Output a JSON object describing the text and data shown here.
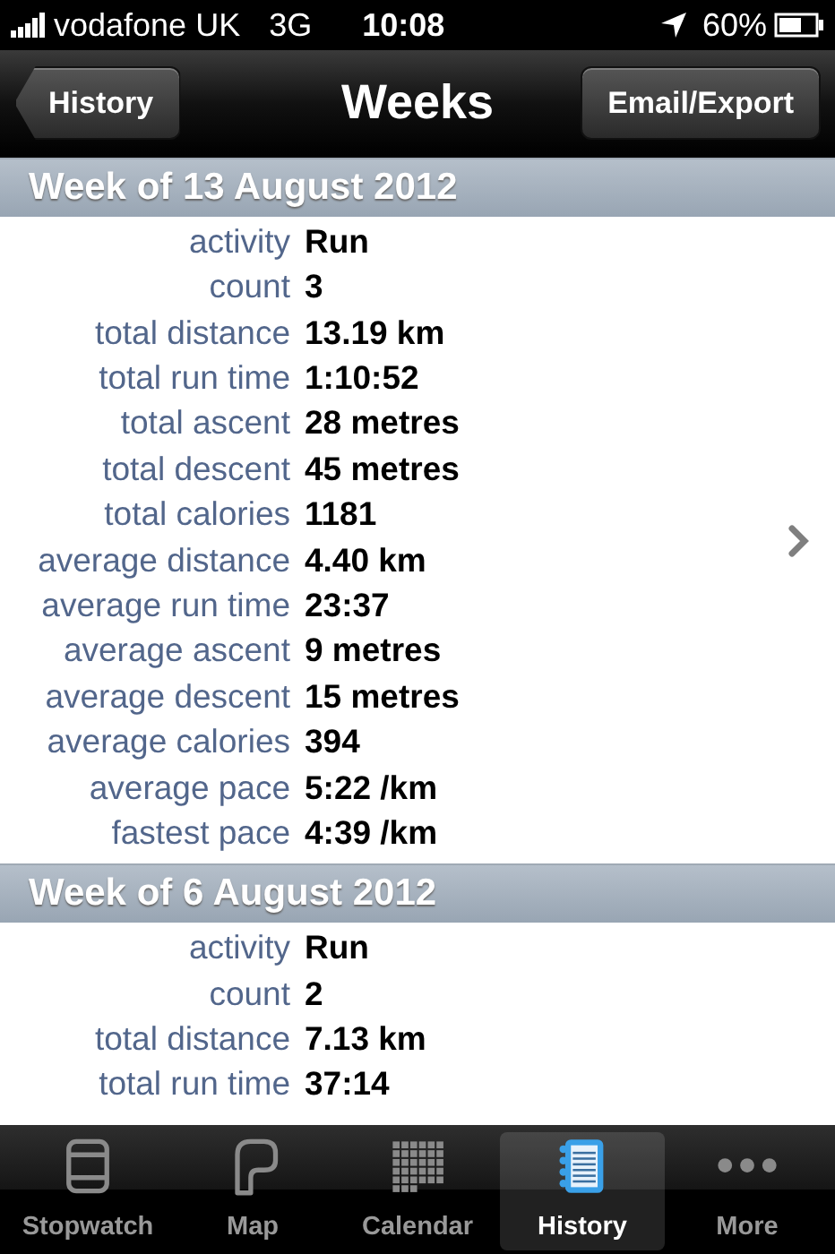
{
  "status_bar": {
    "carrier": "vodafone UK",
    "network": "3G",
    "time": "10:08",
    "battery": "60%"
  },
  "nav_bar": {
    "back": "History",
    "title": "Weeks",
    "action": "Email/Export"
  },
  "sections": [
    {
      "title": "Week of 13 August 2012",
      "disclosure": true,
      "rows": [
        {
          "label": "activity",
          "value": "Run"
        },
        {
          "label": "count",
          "value": "3"
        },
        {
          "label": "total distance",
          "value": "13.19 km"
        },
        {
          "label": "total run time",
          "value": "1:10:52"
        },
        {
          "label": "total ascent",
          "value": "28 metres"
        },
        {
          "label": "total descent",
          "value": "45 metres"
        },
        {
          "label": "total calories",
          "value": "1181"
        },
        {
          "label": "average distance",
          "value": "4.40 km"
        },
        {
          "label": "average run time",
          "value": "23:37"
        },
        {
          "label": "average ascent",
          "value": "9 metres"
        },
        {
          "label": "average descent",
          "value": "15 metres"
        },
        {
          "label": "average calories",
          "value": "394"
        },
        {
          "label": "average pace",
          "value": "5:22 /km"
        },
        {
          "label": "fastest pace",
          "value": "4:39 /km"
        }
      ]
    },
    {
      "title": "Week of 6 August 2012",
      "disclosure": false,
      "rows": [
        {
          "label": "activity",
          "value": "Run"
        },
        {
          "label": "count",
          "value": "2"
        },
        {
          "label": "total distance",
          "value": "7.13 km"
        },
        {
          "label": "total run time",
          "value": "37:14"
        }
      ]
    }
  ],
  "tab_bar": [
    {
      "kind": "stopwatch",
      "label": "Stopwatch",
      "selected": false
    },
    {
      "kind": "map",
      "label": "Map",
      "selected": false
    },
    {
      "kind": "calendar",
      "label": "Calendar",
      "selected": false
    },
    {
      "kind": "history",
      "label": "History",
      "selected": true
    },
    {
      "kind": "more",
      "label": "More",
      "selected": false
    }
  ]
}
